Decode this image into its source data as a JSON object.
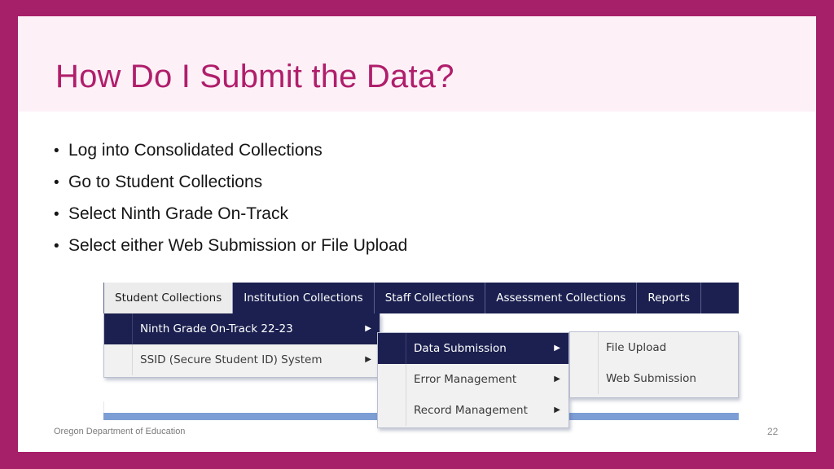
{
  "theme": {
    "frame_color": "#a61f69",
    "title_band_color": "#fdf1f7",
    "title_color": "#b01e6b",
    "body_color": "#ffffff",
    "nav_bar_color": "#1b2050",
    "menu_background": "#f1f1f1",
    "menu_selected_color": "#1b2050",
    "accent_blue": "#7d9ed4"
  },
  "slide": {
    "title": "How Do I Submit the Data?",
    "bullets": [
      {
        "marker": "•",
        "text": "Log into Consolidated Collections"
      },
      {
        "marker": "•",
        "text": "Go to Student Collections"
      },
      {
        "marker": "•",
        "text": "Select Ninth Grade On-Track"
      },
      {
        "marker": "•",
        "text": "Select either Web Submission or File Upload"
      }
    ],
    "footer": {
      "organization": "Oregon Department of Education",
      "page_number": "22"
    }
  },
  "app_screenshot": {
    "nav_tabs": [
      {
        "label": "Student Collections",
        "active": true
      },
      {
        "label": "Institution Collections",
        "active": false
      },
      {
        "label": "Staff Collections",
        "active": false
      },
      {
        "label": "Assessment Collections",
        "active": false
      },
      {
        "label": "Reports",
        "active": false
      }
    ],
    "menu_level_1": {
      "items": [
        {
          "label": "Ninth Grade On-Track 22-23",
          "selected": true,
          "submenu_caret": "▶"
        },
        {
          "label": "SSID (Secure Student ID) System",
          "selected": false,
          "submenu_caret": "▶"
        }
      ]
    },
    "menu_level_2": {
      "items": [
        {
          "label": "Data Submission",
          "selected": true,
          "submenu_caret": "▶"
        },
        {
          "label": "Error Management",
          "selected": false,
          "submenu_caret": "▶"
        },
        {
          "label": "Record Management",
          "selected": false,
          "submenu_caret": "▶"
        }
      ]
    },
    "menu_level_3": {
      "items": [
        {
          "label": "File Upload",
          "selected": false,
          "submenu_caret": ""
        },
        {
          "label": "Web Submission",
          "selected": false,
          "submenu_caret": ""
        }
      ]
    }
  }
}
